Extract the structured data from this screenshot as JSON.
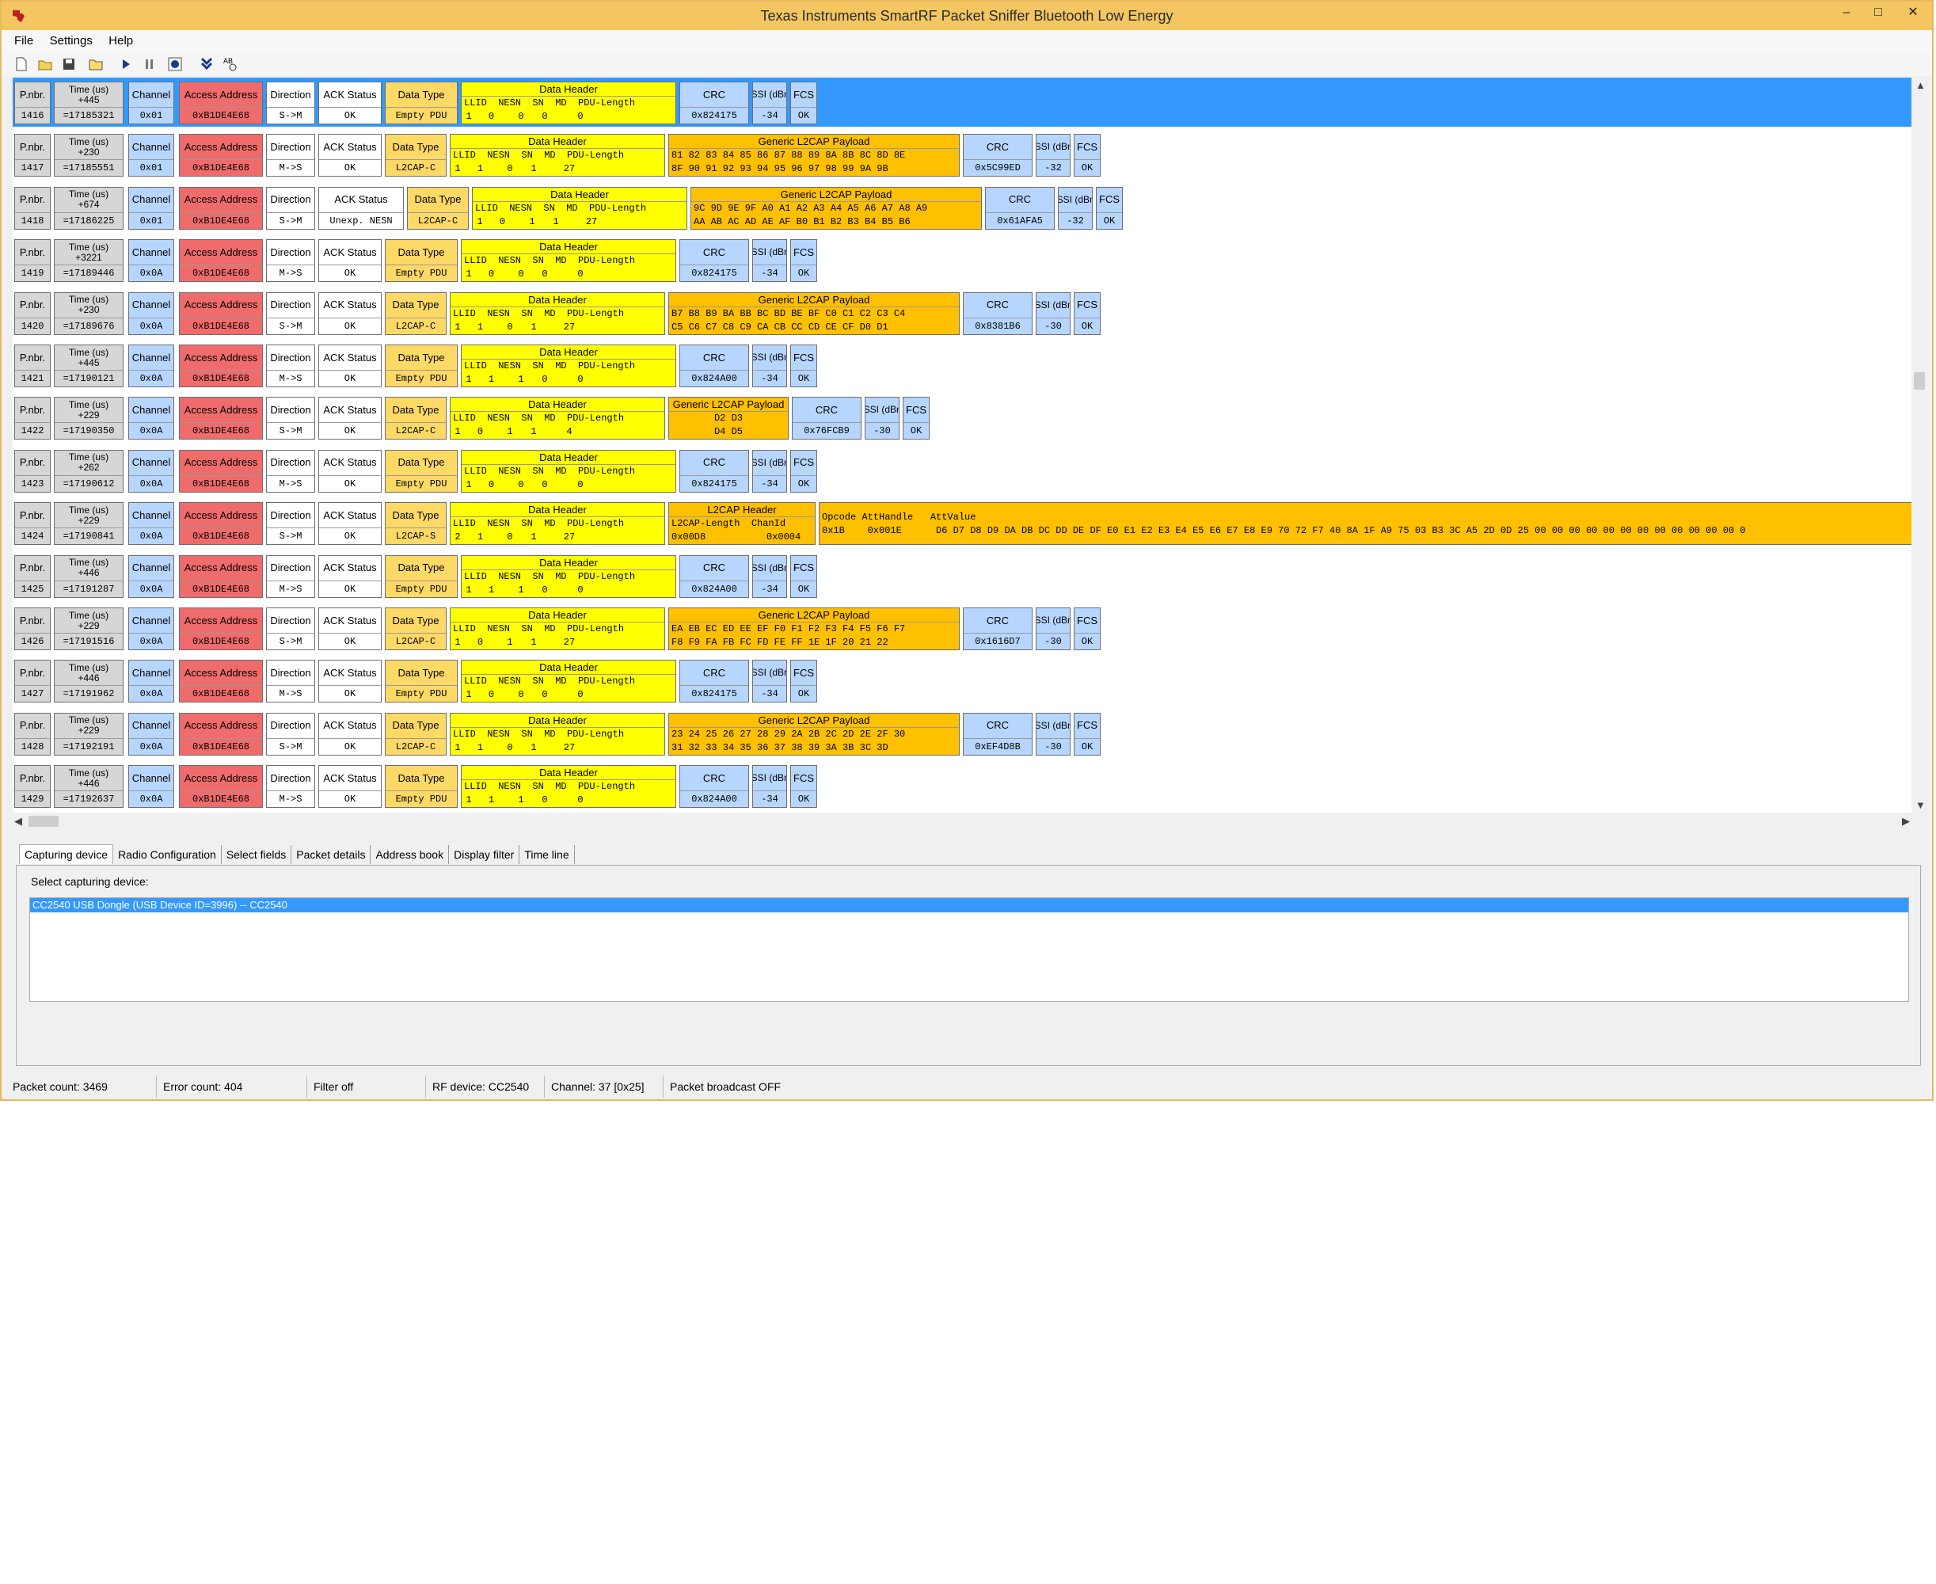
{
  "window": {
    "title": "Texas Instruments SmartRF Packet Sniffer Bluetooth Low Energy"
  },
  "menu": [
    "File",
    "Settings",
    "Help"
  ],
  "toolbar": [
    "new-icon",
    "open-icon",
    "save-icon",
    "folder-icon",
    "play-icon",
    "pause-icon",
    "scroll-icon",
    "down-icon",
    "abc-icon"
  ],
  "labels": {
    "pnbr": "P.nbr.",
    "time": "Time (us)",
    "channel": "Channel",
    "access": "Access Address",
    "direction": "Direction",
    "ack": "ACK Status",
    "dtype": "Data Type",
    "dhdr": "Data Header",
    "dhdr_cols": "LLID  NESN  SN  MD  PDU-Length",
    "payload": "Generic L2CAP Payload",
    "l2cap_hdr": "L2CAP Header",
    "l2cap_cols": "L2CAP-Length  ChanId",
    "att_cols": "Opcode AttHandle   AttValue",
    "crc": "CRC",
    "rssi": "RSSI (dBm)",
    "fcs": "FCS"
  },
  "packets": [
    {
      "nbr": "1416",
      "delta": "+445",
      "time": "=17185321",
      "channel": "0x01",
      "addr": "0xB1DE4E68",
      "dir": "S->M",
      "ack": "OK",
      "dtype": "Empty PDU",
      "llid": "1",
      "nesn": "0",
      "sn": "0",
      "md": "0",
      "len": "0",
      "crc": "0x824175",
      "rssi": "-34",
      "fcs": "OK",
      "selected": true
    },
    {
      "nbr": "1417",
      "delta": "+230",
      "time": "=17185551",
      "channel": "0x01",
      "addr": "0xB1DE4E68",
      "dir": "M->S",
      "ack": "OK",
      "dtype": "L2CAP-C",
      "llid": "1",
      "nesn": "1",
      "sn": "0",
      "md": "1",
      "len": "27",
      "payload": [
        "81 82 83 84 85 86 87 88 89 8A 8B 8C 8D 8E",
        "8F 90 91 92 93 94 95 96 97 98 99 9A 9B"
      ],
      "crc": "0x5C99ED",
      "rssi": "-32",
      "fcs": "OK"
    },
    {
      "nbr": "1418",
      "delta": "+674",
      "time": "=17186225",
      "channel": "0x01",
      "addr": "0xB1DE4E68",
      "dir": "S->M",
      "ack": "Unexp. NESN",
      "dtype": "L2CAP-C",
      "llid": "1",
      "nesn": "0",
      "sn": "1",
      "md": "1",
      "len": "27",
      "payload": [
        "9C 9D 9E 9F A0 A1 A2 A3 A4 A5 A6 A7 A8 A9",
        "AA AB AC AD AE AF B0 B1 B2 B3 B4 B5 B6"
      ],
      "crc": "0x61AFA5",
      "rssi": "-32",
      "fcs": "OK"
    },
    {
      "nbr": "1419",
      "delta": "+3221",
      "time": "=17189446",
      "channel": "0x0A",
      "addr": "0xB1DE4E68",
      "dir": "M->S",
      "ack": "OK",
      "dtype": "Empty PDU",
      "llid": "1",
      "nesn": "0",
      "sn": "0",
      "md": "0",
      "len": "0",
      "crc": "0x824175",
      "rssi": "-34",
      "fcs": "OK"
    },
    {
      "nbr": "1420",
      "delta": "+230",
      "time": "=17189676",
      "channel": "0x0A",
      "addr": "0xB1DE4E68",
      "dir": "S->M",
      "ack": "OK",
      "dtype": "L2CAP-C",
      "llid": "1",
      "nesn": "1",
      "sn": "0",
      "md": "1",
      "len": "27",
      "payload": [
        "B7 B8 B9 BA BB BC BD BE BF C0 C1 C2 C3 C4",
        "C5 C6 C7 C8 C9 CA CB CC CD CE CF D0 D1"
      ],
      "crc": "0x8381B6",
      "rssi": "-30",
      "fcs": "OK"
    },
    {
      "nbr": "1421",
      "delta": "+445",
      "time": "=17190121",
      "channel": "0x0A",
      "addr": "0xB1DE4E68",
      "dir": "M->S",
      "ack": "OK",
      "dtype": "Empty PDU",
      "llid": "1",
      "nesn": "1",
      "sn": "1",
      "md": "0",
      "len": "0",
      "crc": "0x824A00",
      "rssi": "-34",
      "fcs": "OK"
    },
    {
      "nbr": "1422",
      "delta": "+229",
      "time": "=17190350",
      "channel": "0x0A",
      "addr": "0xB1DE4E68",
      "dir": "S->M",
      "ack": "OK",
      "dtype": "L2CAP-C",
      "llid": "1",
      "nesn": "0",
      "sn": "1",
      "md": "1",
      "len": "4",
      "payload": [
        "D2 D3",
        "D4 D5"
      ],
      "crc": "0x76FCB9",
      "rssi": "-30",
      "fcs": "OK",
      "narrow": true
    },
    {
      "nbr": "1423",
      "delta": "+262",
      "time": "=17190612",
      "channel": "0x0A",
      "addr": "0xB1DE4E68",
      "dir": "M->S",
      "ack": "OK",
      "dtype": "Empty PDU",
      "llid": "1",
      "nesn": "0",
      "sn": "0",
      "md": "0",
      "len": "0",
      "crc": "0x824175",
      "rssi": "-34",
      "fcs": "OK"
    },
    {
      "nbr": "1424",
      "delta": "+229",
      "time": "=17190841",
      "channel": "0x0A",
      "addr": "0xB1DE4E68",
      "dir": "S->M",
      "ack": "OK",
      "dtype": "L2CAP-S",
      "llid": "2",
      "nesn": "1",
      "sn": "0",
      "md": "1",
      "len": "27",
      "l2len": "0x00D8",
      "chanid": "0x0004",
      "att": "0x1B    0x001E      D6 D7 D8 D9 DA DB DC DD DE DF E0 E1 E2 E3 E4 E5 E6 E7 E8 E9 70 72 F7 40 8A 1F A9 75 03 B3 3C A5 2D 0D 25 00 00 00 00 00 00 00 00 00 00 00 00 0"
    },
    {
      "nbr": "1425",
      "delta": "+446",
      "time": "=17191287",
      "channel": "0x0A",
      "addr": "0xB1DE4E68",
      "dir": "M->S",
      "ack": "OK",
      "dtype": "Empty PDU",
      "llid": "1",
      "nesn": "1",
      "sn": "1",
      "md": "0",
      "len": "0",
      "crc": "0x824A00",
      "rssi": "-34",
      "fcs": "OK"
    },
    {
      "nbr": "1426",
      "delta": "+229",
      "time": "=17191516",
      "channel": "0x0A",
      "addr": "0xB1DE4E68",
      "dir": "S->M",
      "ack": "OK",
      "dtype": "L2CAP-C",
      "llid": "1",
      "nesn": "0",
      "sn": "1",
      "md": "1",
      "len": "27",
      "payload": [
        "EA EB EC ED EE EF F0 F1 F2 F3 F4 F5 F6 F7",
        "F8 F9 FA FB FC FD FE FF 1E 1F 20 21 22"
      ],
      "crc": "0x1616D7",
      "rssi": "-30",
      "fcs": "OK"
    },
    {
      "nbr": "1427",
      "delta": "+446",
      "time": "=17191962",
      "channel": "0x0A",
      "addr": "0xB1DE4E68",
      "dir": "M->S",
      "ack": "OK",
      "dtype": "Empty PDU",
      "llid": "1",
      "nesn": "0",
      "sn": "0",
      "md": "0",
      "len": "0",
      "crc": "0x824175",
      "rssi": "-34",
      "fcs": "OK"
    },
    {
      "nbr": "1428",
      "delta": "+229",
      "time": "=17192191",
      "channel": "0x0A",
      "addr": "0xB1DE4E68",
      "dir": "S->M",
      "ack": "OK",
      "dtype": "L2CAP-C",
      "llid": "1",
      "nesn": "1",
      "sn": "0",
      "md": "1",
      "len": "27",
      "payload": [
        "23 24 25 26 27 28 29 2A 2B 2C 2D 2E 2F 30",
        "31 32 33 34 35 36 37 38 39 3A 3B 3C 3D"
      ],
      "crc": "0xEF4D8B",
      "rssi": "-30",
      "fcs": "OK"
    },
    {
      "nbr": "1429",
      "delta": "+446",
      "time": "=17192637",
      "channel": "0x0A",
      "addr": "0xB1DE4E68",
      "dir": "M->S",
      "ack": "OK",
      "dtype": "Empty PDU",
      "llid": "1",
      "nesn": "1",
      "sn": "1",
      "md": "0",
      "len": "0",
      "crc": "0x824A00",
      "rssi": "-34",
      "fcs": "OK"
    }
  ],
  "tabs": [
    "Capturing device",
    "Radio Configuration",
    "Select fields",
    "Packet details",
    "Address book",
    "Display filter",
    "Time line"
  ],
  "panel": {
    "label": "Select capturing device:",
    "device": "CC2540 USB Dongle (USB Device ID=3996) -- CC2540"
  },
  "status": [
    "Packet count: 3469",
    "Error count: 404",
    "Filter off",
    "RF device: CC2540",
    "Channel: 37 [0x25]",
    "Packet broadcast OFF"
  ],
  "colors": {
    "selected": "#3399ff",
    "header": "#ffff00",
    "payload": "#ffc000",
    "address": "#f06b6b",
    "blue": "#b7d6ff",
    "titlebar": "#f3c662"
  }
}
